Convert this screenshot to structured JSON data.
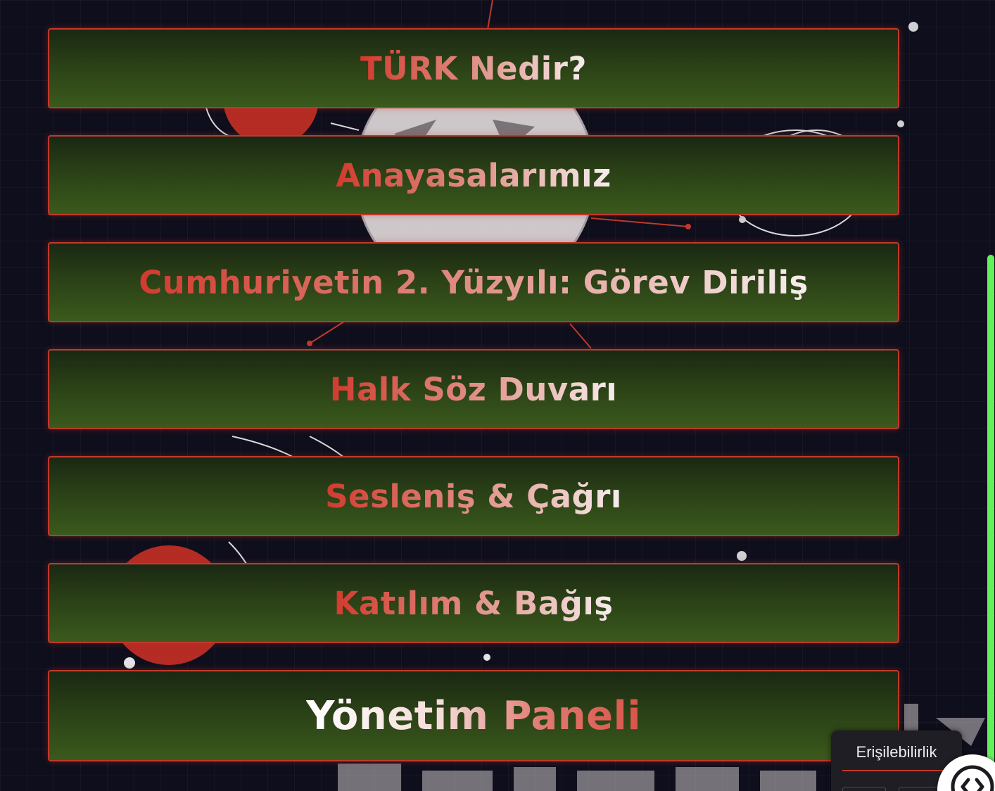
{
  "menu": {
    "items": [
      {
        "label": "TÜRK Nedir?"
      },
      {
        "label": "Anayasalarımız"
      },
      {
        "label": "Cumhuriyetin 2. Yüzyılı: Görev Diriliş"
      },
      {
        "label": "Halk Söz Duvarı"
      },
      {
        "label": "Sesleniş & Çağrı"
      },
      {
        "label": "Katılım & Bağış"
      },
      {
        "label": "Yönetim Paneli"
      }
    ]
  },
  "accessibility": {
    "label": "Erişilebilirlik",
    "toggle_icon": "accessibility-toggle-icon"
  },
  "colors": {
    "button_border": "#c0392b",
    "button_fill_top": "#1a2813",
    "button_fill_bottom": "#3b5a1d",
    "text_red": "#d23a2e",
    "text_white": "#f7eeee",
    "scrollbar": "#63f05a",
    "page_background": "#0f0e1c"
  }
}
